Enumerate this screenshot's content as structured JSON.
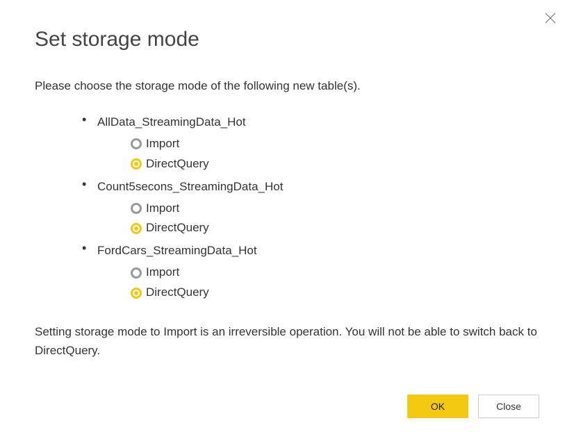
{
  "title": "Set storage mode",
  "instruction": "Please choose the storage mode of the following new table(s).",
  "tables": [
    {
      "name": "AllData_StreamingData_Hot",
      "options": [
        {
          "label": "Import",
          "selected": false
        },
        {
          "label": "DirectQuery",
          "selected": true
        }
      ]
    },
    {
      "name": "Count5secons_StreamingData_Hot",
      "options": [
        {
          "label": "Import",
          "selected": false
        },
        {
          "label": "DirectQuery",
          "selected": true
        }
      ]
    },
    {
      "name": "FordCars_StreamingData_Hot",
      "options": [
        {
          "label": "Import",
          "selected": false
        },
        {
          "label": "DirectQuery",
          "selected": true
        }
      ]
    }
  ],
  "warning": "Setting storage mode to Import is an irreversible operation. You will not be able to switch back to DirectQuery.",
  "buttons": {
    "ok": "OK",
    "close": "Close"
  }
}
